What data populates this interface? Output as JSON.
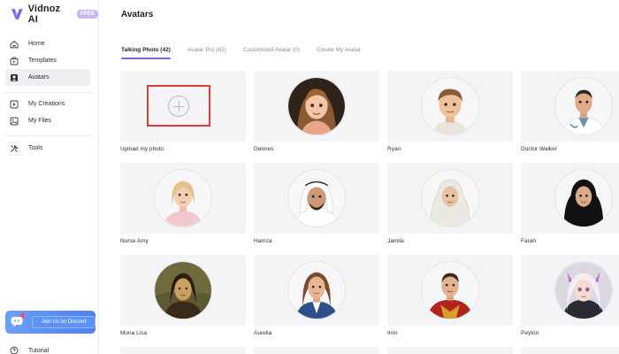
{
  "brand": {
    "name": "Vidnoz AI",
    "badge": "FREE",
    "accent": "#7b61ff"
  },
  "sidebar": {
    "items": [
      {
        "label": "Home",
        "icon": "home-icon"
      },
      {
        "label": "Templates",
        "icon": "templates-icon"
      },
      {
        "label": "Avatars",
        "icon": "avatar-icon",
        "active": true
      },
      {
        "label": "My Creations",
        "icon": "play-icon"
      },
      {
        "label": "My Files",
        "icon": "image-icon"
      },
      {
        "label": "Tools",
        "icon": "tools-icon"
      }
    ],
    "discord_label": "Join Us on Discord",
    "tutorial_label": "Tutorial"
  },
  "page": {
    "title": "Avatars"
  },
  "tabs": [
    {
      "label": "Talking Photo (42)",
      "active": true
    },
    {
      "label": "Avatar Pro (81)"
    },
    {
      "label": "Customized Avatar (0)"
    },
    {
      "label": "Create My Avatar"
    }
  ],
  "cards": [
    {
      "label": "Upload my photo",
      "type": "upload"
    },
    {
      "label": "Delores"
    },
    {
      "label": "Ryan"
    },
    {
      "label": "Doctor Walker"
    },
    {
      "label": "Nurse Amy"
    },
    {
      "label": "Hamza"
    },
    {
      "label": "Jamila"
    },
    {
      "label": "Farah"
    },
    {
      "label": "Mona Lisa"
    },
    {
      "label": "Aurelia"
    },
    {
      "label": "Iron"
    },
    {
      "label": "Peyton"
    }
  ]
}
